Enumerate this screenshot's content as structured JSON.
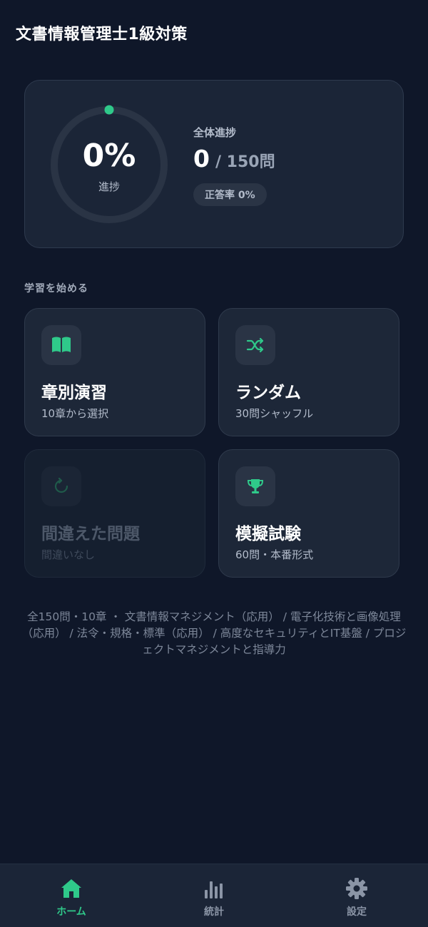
{
  "app": {
    "title": "文書情報管理士1級対策"
  },
  "progress": {
    "percent_text": "0%",
    "percent_value": 0,
    "caption": "進捗",
    "overall_label": "全体進捗",
    "solved": "0",
    "total_text": "/ 150問",
    "accuracy": "正答率 0%"
  },
  "section": {
    "label": "学習を始める"
  },
  "modes": [
    {
      "title": "章別演習",
      "subtitle": "10章から選択",
      "icon": "book-icon",
      "enabled": true
    },
    {
      "title": "ランダム",
      "subtitle": "30問シャッフル",
      "icon": "shuffle-icon",
      "enabled": true
    },
    {
      "title": "間違えた問題",
      "subtitle": "間違いなし",
      "icon": "retry-icon",
      "enabled": false
    },
    {
      "title": "模擬試験",
      "subtitle": "60問・本番形式",
      "icon": "trophy-icon",
      "enabled": true
    }
  ],
  "footer_note": "全150問・10章 ・ 文書情報マネジメント（応用） / 電子化技術と画像処理（応用） / 法令・規格・標準（応用） / 高度なセキュリティとIT基盤 / プロジェクトマネジメントと指導力",
  "tabs": [
    {
      "label": "ホーム",
      "icon": "home-icon",
      "active": true
    },
    {
      "label": "統計",
      "icon": "bar-chart-icon",
      "active": false
    },
    {
      "label": "設定",
      "icon": "gear-icon",
      "active": false
    }
  ],
  "colors": {
    "background": "#0f1729",
    "card": "#1b2537",
    "accent": "#2fc98a",
    "text_muted": "#b3bccb",
    "tab_inactive": "#8b95a6"
  }
}
